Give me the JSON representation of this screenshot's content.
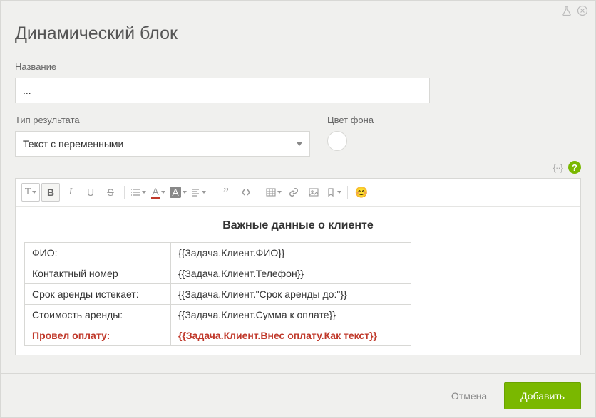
{
  "header": {
    "title": "Динамический блок"
  },
  "form": {
    "name_label": "Название",
    "name_value": "...",
    "result_type_label": "Тип результата",
    "result_type_value": "Текст с переменными",
    "bg_color_label": "Цвет фона"
  },
  "editor": {
    "heading": "Важные данные о клиенте",
    "rows": [
      {
        "label": "ФИО:",
        "value": "{{Задача.Клиент.ФИО}}"
      },
      {
        "label": "Контактный номер",
        "value": "{{Задача.Клиент.Телефон}}"
      },
      {
        "label": "Срок аренды истекает:",
        "value": "{{Задача.Клиент.\"Срок аренды до:\"}}"
      },
      {
        "label": "Стоимость аренды:",
        "value": "{{Задача.Клиент.Сумма к оплате}}"
      },
      {
        "label": "Провел оплату:",
        "value": "{{Задача.Клиент.Внес оплату.Как текст}}",
        "highlight": true
      }
    ]
  },
  "footer": {
    "cancel": "Отмена",
    "submit": "Добавить"
  },
  "icons": {
    "help_glyph": "?",
    "brackets": "{··}"
  }
}
